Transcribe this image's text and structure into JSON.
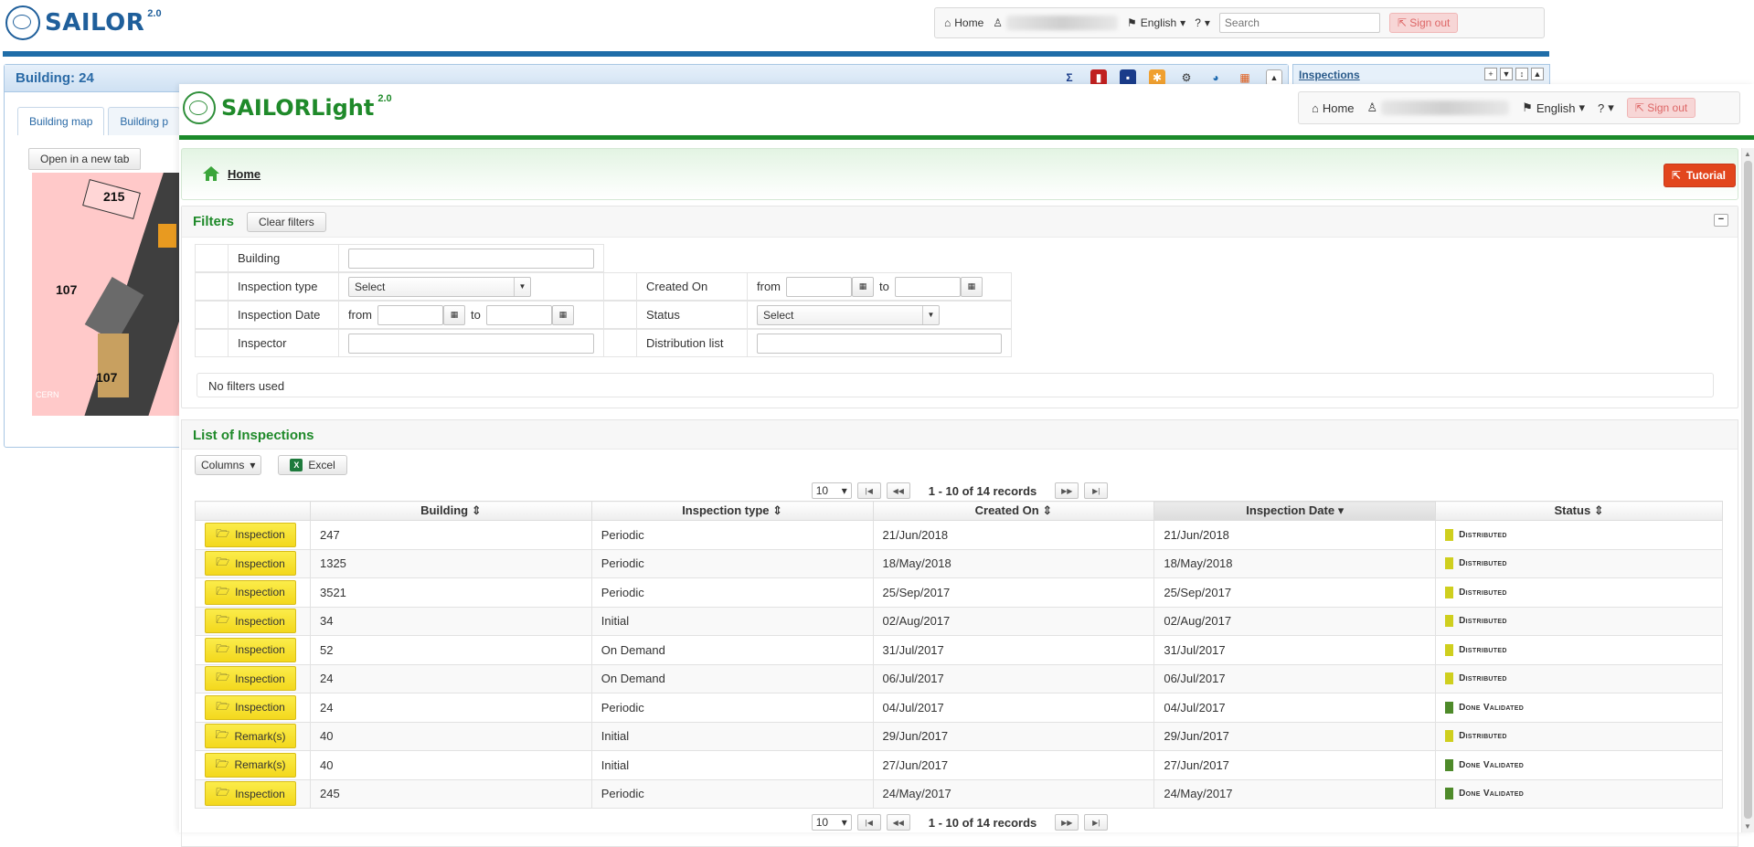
{
  "background_app": {
    "logo": "SAILOR",
    "version": "2.0",
    "nav": {
      "home": "Home",
      "language": "English",
      "help": "?",
      "search_placeholder": "Search",
      "signout": "Sign out"
    },
    "building_title": "Building: 24",
    "tabs": [
      "Building map",
      "Building p"
    ],
    "open_new_tab": "Open in a new tab",
    "map_labels": [
      "215",
      "107",
      "107"
    ],
    "map_credit": "CERN",
    "inspections_link": "Inspections"
  },
  "app": {
    "logo": "SAILORLight",
    "version": "2.0",
    "nav": {
      "home": "Home",
      "language": "English",
      "help": "?",
      "signout": "Sign out"
    }
  },
  "home_bar": {
    "link": "Home",
    "tutorial": "Tutorial"
  },
  "filters": {
    "title": "Filters",
    "clear": "Clear filters",
    "building": "Building",
    "inspection_type": "Inspection type",
    "inspection_date": "Inspection Date",
    "inspector": "Inspector",
    "created_on": "Created On",
    "status": "Status",
    "distribution_list": "Distribution list",
    "select": "Select",
    "from": "from",
    "to": "to",
    "none_used": "No filters used"
  },
  "list": {
    "title": "List of Inspections",
    "columns_btn": "Columns",
    "excel_btn": "Excel",
    "page_size": "10",
    "records": "1 - 10 of 14 records",
    "headers": [
      "Building",
      "Inspection type",
      "Created On",
      "Inspection Date",
      "Status"
    ],
    "rows": [
      {
        "action": "Inspection",
        "building": "247",
        "type": "Periodic",
        "created": "21/Jun/2018",
        "date": "21/Jun/2018",
        "status": "Distributed",
        "status_color": "#cfcf1e"
      },
      {
        "action": "Inspection",
        "building": "1325",
        "type": "Periodic",
        "created": "18/May/2018",
        "date": "18/May/2018",
        "status": "Distributed",
        "status_color": "#cfcf1e"
      },
      {
        "action": "Inspection",
        "building": "3521",
        "type": "Periodic",
        "created": "25/Sep/2017",
        "date": "25/Sep/2017",
        "status": "Distributed",
        "status_color": "#cfcf1e"
      },
      {
        "action": "Inspection",
        "building": "34",
        "type": "Initial",
        "created": "02/Aug/2017",
        "date": "02/Aug/2017",
        "status": "Distributed",
        "status_color": "#cfcf1e"
      },
      {
        "action": "Inspection",
        "building": "52",
        "type": "On Demand",
        "created": "31/Jul/2017",
        "date": "31/Jul/2017",
        "status": "Distributed",
        "status_color": "#cfcf1e"
      },
      {
        "action": "Inspection",
        "building": "24",
        "type": "On Demand",
        "created": "06/Jul/2017",
        "date": "06/Jul/2017",
        "status": "Distributed",
        "status_color": "#cfcf1e"
      },
      {
        "action": "Inspection",
        "building": "24",
        "type": "Periodic",
        "created": "04/Jul/2017",
        "date": "04/Jul/2017",
        "status": "Done Validated",
        "status_color": "#4e8a2a"
      },
      {
        "action": "Remark(s)",
        "building": "40",
        "type": "Initial",
        "created": "29/Jun/2017",
        "date": "29/Jun/2017",
        "status": "Distributed",
        "status_color": "#cfcf1e"
      },
      {
        "action": "Remark(s)",
        "building": "40",
        "type": "Initial",
        "created": "27/Jun/2017",
        "date": "27/Jun/2017",
        "status": "Done Validated",
        "status_color": "#4e8a2a"
      },
      {
        "action": "Inspection",
        "building": "245",
        "type": "Periodic",
        "created": "24/May/2017",
        "date": "24/May/2017",
        "status": "Done Validated",
        "status_color": "#4e8a2a"
      }
    ]
  }
}
